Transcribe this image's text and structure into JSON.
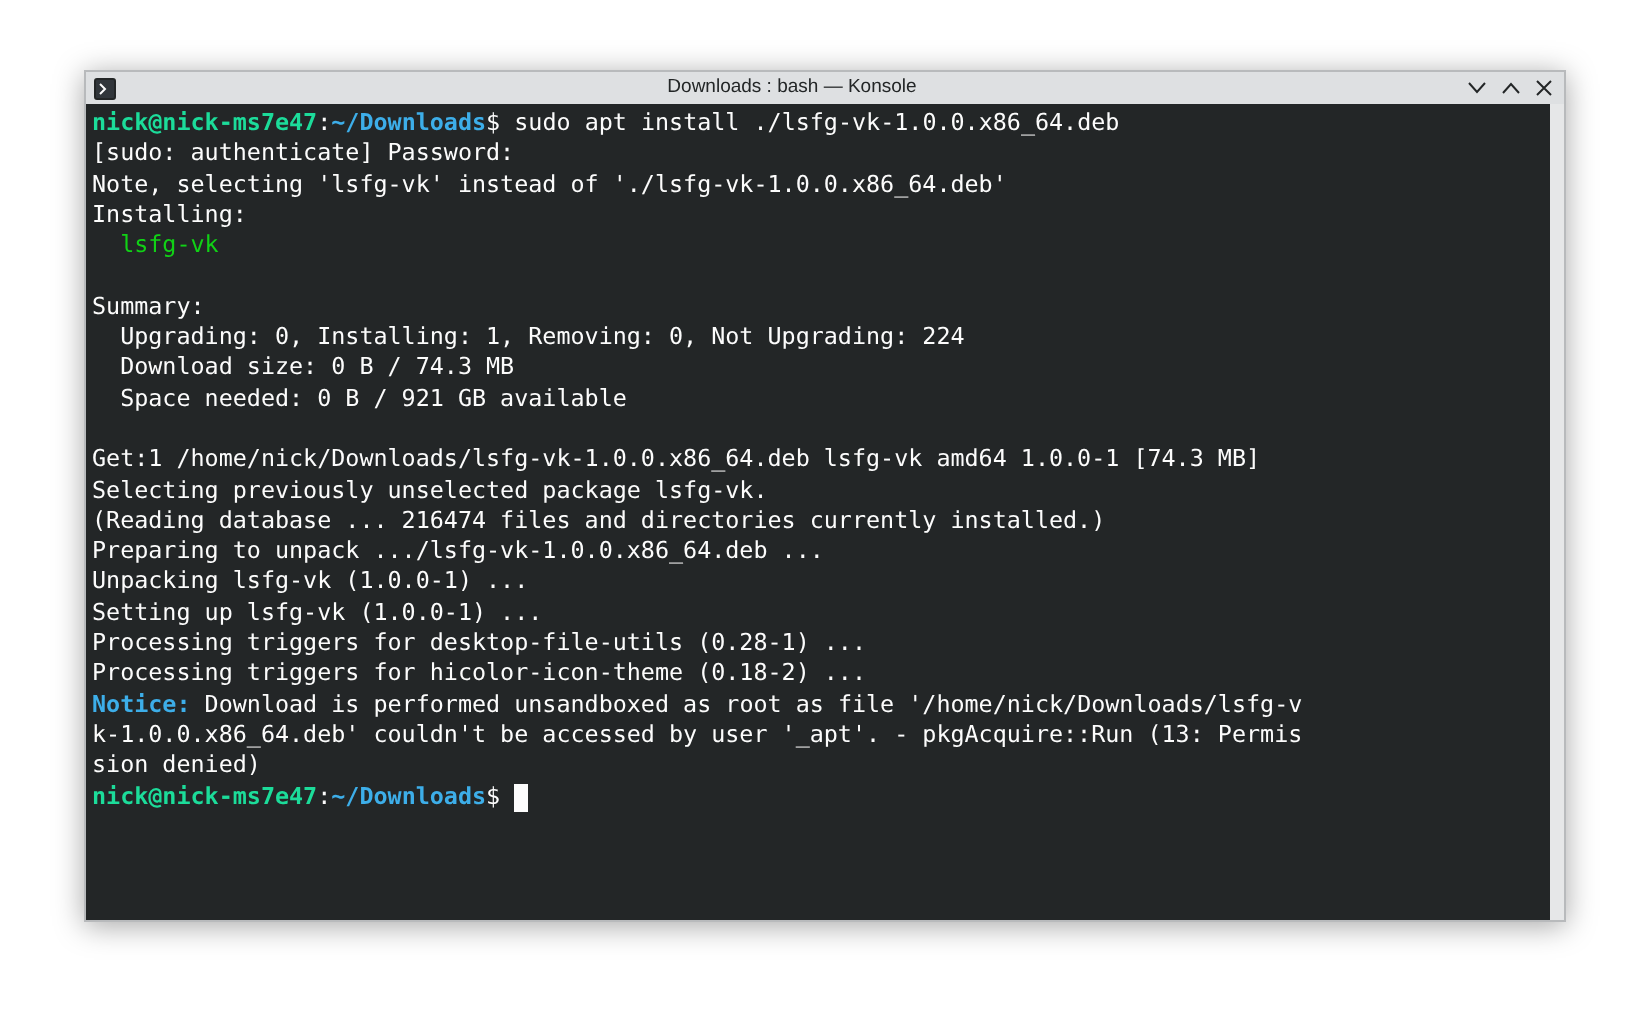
{
  "window": {
    "title": "Downloads : bash — Konsole"
  },
  "terminal": {
    "lines": [
      {
        "kind": "prompt",
        "user": "nick@nick-ms7e47",
        "separator": ":",
        "path": "~/Downloads",
        "symbol": "$",
        "command": " sudo apt install ./lsfg-vk-1.0.0.x86_64.deb"
      },
      {
        "kind": "text",
        "text": "[sudo: authenticate] Password:"
      },
      {
        "kind": "text",
        "text": "Note, selecting 'lsfg-vk' instead of './lsfg-vk-1.0.0.x86_64.deb'"
      },
      {
        "kind": "text",
        "text": "Installing:"
      },
      {
        "kind": "package",
        "text": "  lsfg-vk"
      },
      {
        "kind": "blank"
      },
      {
        "kind": "text",
        "text": "Summary:"
      },
      {
        "kind": "text",
        "text": "  Upgrading: 0, Installing: 1, Removing: 0, Not Upgrading: 224"
      },
      {
        "kind": "text",
        "text": "  Download size: 0 B / 74.3 MB"
      },
      {
        "kind": "text",
        "text": "  Space needed: 0 B / 921 GB available"
      },
      {
        "kind": "blank"
      },
      {
        "kind": "text",
        "text": "Get:1 /home/nick/Downloads/lsfg-vk-1.0.0.x86_64.deb lsfg-vk amd64 1.0.0-1 [74.3 MB]"
      },
      {
        "kind": "text",
        "text": "Selecting previously unselected package lsfg-vk."
      },
      {
        "kind": "text",
        "text": "(Reading database ... 216474 files and directories currently installed.)"
      },
      {
        "kind": "text",
        "text": "Preparing to unpack .../lsfg-vk-1.0.0.x86_64.deb ..."
      },
      {
        "kind": "text",
        "text": "Unpacking lsfg-vk (1.0.0-1) ..."
      },
      {
        "kind": "text",
        "text": "Setting up lsfg-vk (1.0.0-1) ..."
      },
      {
        "kind": "text",
        "text": "Processing triggers for desktop-file-utils (0.28-1) ..."
      },
      {
        "kind": "text",
        "text": "Processing triggers for hicolor-icon-theme (0.18-2) ..."
      },
      {
        "kind": "notice",
        "label": "Notice:",
        "text": " Download is performed unsandboxed as root as file '/home/nick/Downloads/lsfg-v"
      },
      {
        "kind": "text",
        "text": "k-1.0.0.x86_64.deb' couldn't be accessed by user '_apt'. - pkgAcquire::Run (13: Permis"
      },
      {
        "kind": "text",
        "text": "sion denied)"
      },
      {
        "kind": "prompt",
        "user": "nick@nick-ms7e47",
        "separator": ":",
        "path": "~/Downloads",
        "symbol": "$",
        "cursor": true
      }
    ]
  }
}
